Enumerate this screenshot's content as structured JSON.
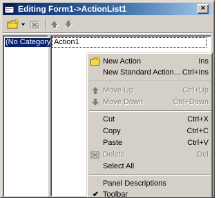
{
  "window": {
    "title": "Editing Form1->ActionList1",
    "close_label": "×"
  },
  "categories": {
    "items": [
      {
        "label": "(No Category)",
        "selected": true
      }
    ]
  },
  "actions": {
    "items": [
      {
        "label": "Action1"
      }
    ]
  },
  "context_menu": {
    "items": [
      {
        "label": "New Action",
        "shortcut": "Ins",
        "icon": "new-action-icon",
        "enabled": true
      },
      {
        "label": "New Standard Action...",
        "shortcut": "Ctrl+Ins",
        "enabled": true
      },
      {
        "label": "Move Up",
        "shortcut": "Ctrl+Up",
        "icon": "arrow-up-icon",
        "enabled": false
      },
      {
        "label": "Move Down",
        "shortcut": "Ctrl+Down",
        "icon": "arrow-down-icon",
        "enabled": false
      },
      {
        "label": "Cut",
        "shortcut": "Ctrl+X",
        "enabled": true
      },
      {
        "label": "Copy",
        "shortcut": "Ctrl+C",
        "enabled": true
      },
      {
        "label": "Paste",
        "shortcut": "Ctrl+V",
        "enabled": true
      },
      {
        "label": "Delete",
        "shortcut": "Del",
        "icon": "delete-icon",
        "enabled": false
      },
      {
        "label": "Select All",
        "shortcut": "",
        "enabled": true
      },
      {
        "label": "Panel Descriptions",
        "shortcut": "",
        "enabled": true
      },
      {
        "label": "Toolbar",
        "shortcut": "",
        "checked": true,
        "check_glyph": "✔",
        "enabled": true
      }
    ]
  },
  "colors": {
    "title_gradient_start": "#0a246a",
    "title_gradient_end": "#a6caf0",
    "face": "#d4d0c8",
    "selection": "#0a246a",
    "disabled_text": "#808080"
  }
}
